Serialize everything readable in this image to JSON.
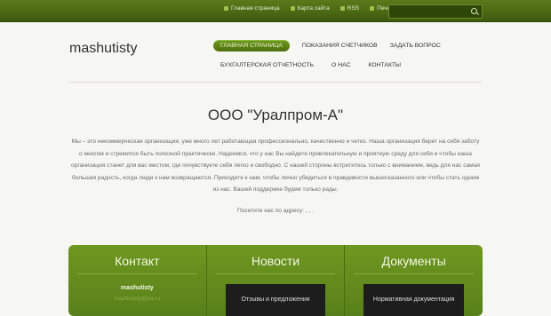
{
  "topnav": [
    {
      "label": "Главная страница",
      "icon": "home-icon"
    },
    {
      "label": "Карта сайта",
      "icon": "sitemap-icon"
    },
    {
      "label": "RSS",
      "icon": "rss-icon"
    },
    {
      "label": "Печать",
      "icon": "print-icon"
    }
  ],
  "search": {
    "placeholder": "",
    "value": ""
  },
  "logo": "mashutisty",
  "mainnav": {
    "row1": [
      "ГЛАВНАЯ СТРАНИЦА",
      "ПОКАЗАНИЯ СЧЕТЧИКОВ",
      "ЗАДАТЬ ВОПРОС"
    ],
    "row2": [
      "БУХГАЛТЕРСКАЯ ОТЧЕТНОСТЬ",
      "О НАС",
      "КОНТАКТЫ"
    ]
  },
  "page_title": "ООО \"Уралпром-А\"",
  "intro": "Мы – это некоммерческая организация, уже много лет работающая профессионально, качественно и четко. Наша организация берет на себя заботу о многом и стремится быть полезной практически. Надеемся, что у нас Вы найдете привлекательную и приятную среду для себя и чтобы наша организация станет для вас местом, где почувствуете себя легко и свободно. С нашей стороны встретитесь только с вниманием, ведь для нас самая большая радость, когда люди к нам возвращаются. Приходите к нам, чтобы лично убедиться в правдивости вышесказанного или чтобы стать одним из нас. Вашей поддержке будем только рады.",
  "address": "Посетите нас по адресу: , , .",
  "boxes": {
    "contact": {
      "title": "Контакт",
      "name": "mashutisty",
      "email": "mashutisty@ya.ru"
    },
    "news": {
      "title": "Новости",
      "item": "Отзывы и предложения"
    },
    "docs": {
      "title": "Документы",
      "item": "Нормативная документация"
    }
  },
  "colors": {
    "accent": "#5b7a1a",
    "active_tab": "#6e9a1c",
    "boxes_bg": "#6f9720"
  }
}
